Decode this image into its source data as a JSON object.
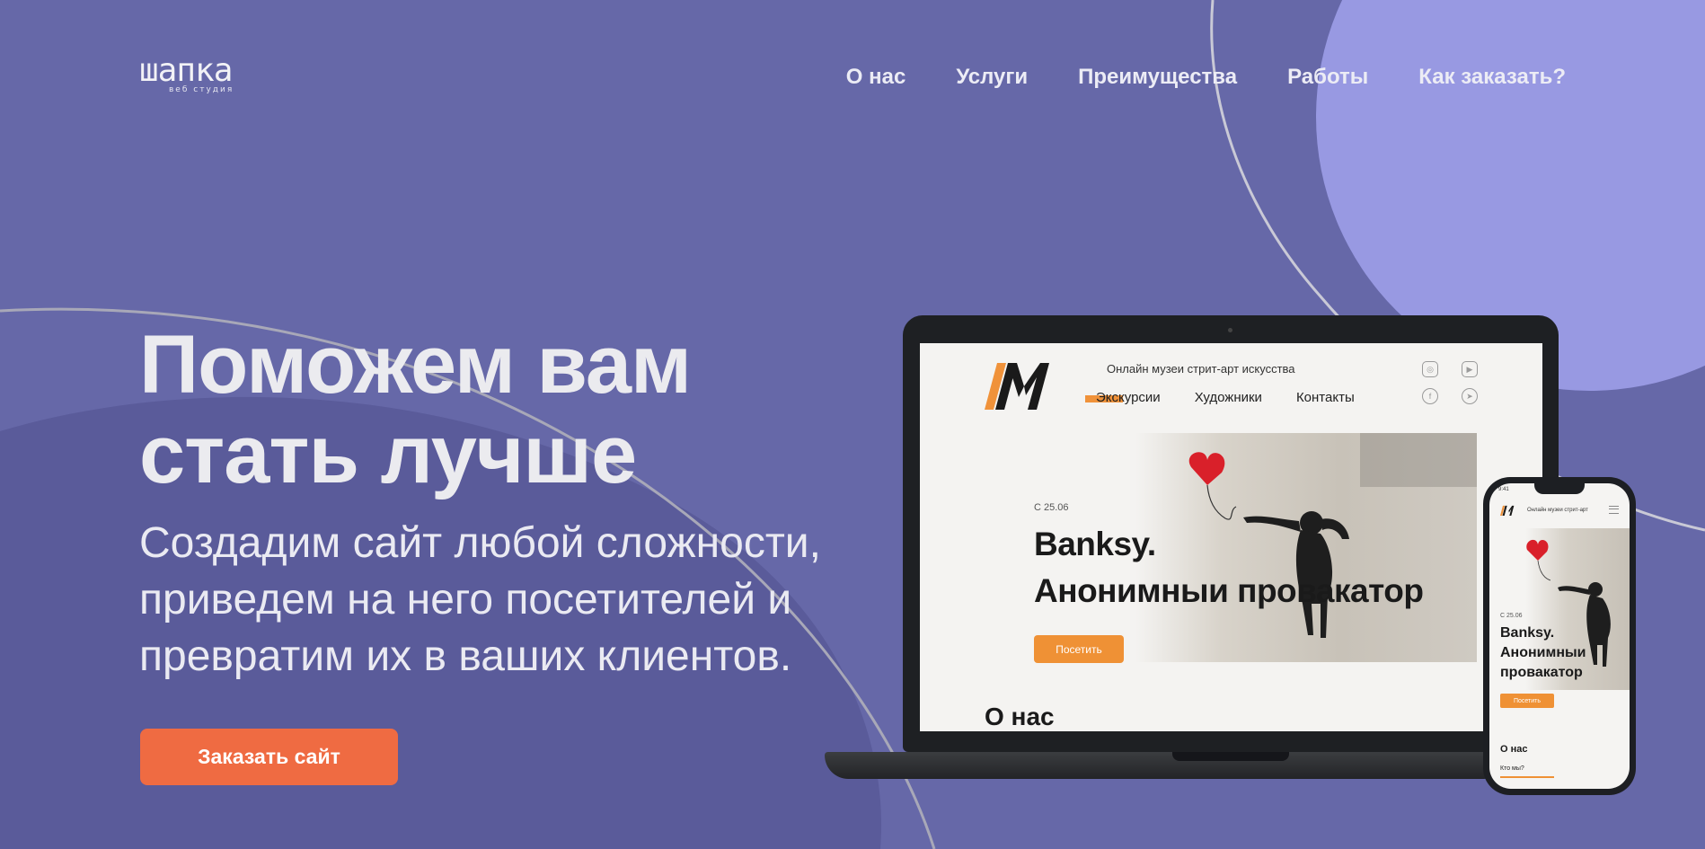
{
  "brand": {
    "logo_word": "шапка",
    "logo_sub": "веб студия"
  },
  "nav": {
    "items": [
      "О нас",
      "Услуги",
      "Преимущества",
      "Работы",
      "Как заказать?"
    ]
  },
  "hero": {
    "title_line1": "Поможем вам",
    "title_line2": "стать лучше",
    "subtitle_line1": "Создадим сайт любой сложности,",
    "subtitle_line2": "приведем на него посетителей и",
    "subtitle_line3": "превратим их в ваших клиентов.",
    "cta_label": "Заказать сайт"
  },
  "mockup_laptop": {
    "tagline": "Онлайн музеи стрит-арт искусства",
    "nav": [
      "Экскурсии",
      "Художники",
      "Контакты"
    ],
    "date": "С 25.06",
    "title_line1": "Banksy.",
    "title_line2": "Анонимныи провакатор",
    "button": "Посетить",
    "section_title": "О нас"
  },
  "mockup_phone": {
    "time": "9:41",
    "tagline": "Онлайн музеи стрит-арт",
    "date": "С 25.06",
    "title_line1": "Banksy.",
    "title_line2": "Анонимныи",
    "title_line3": "провакатор",
    "button": "Посетить",
    "section_title": "О нас",
    "sub_link": "Кто мы?"
  },
  "colors": {
    "background": "#6668a8",
    "blob_light": "#9899e2",
    "blob_dark": "#5a5b9a",
    "accent_cta": "#ef6b42",
    "accent_site": "#ef9135"
  }
}
